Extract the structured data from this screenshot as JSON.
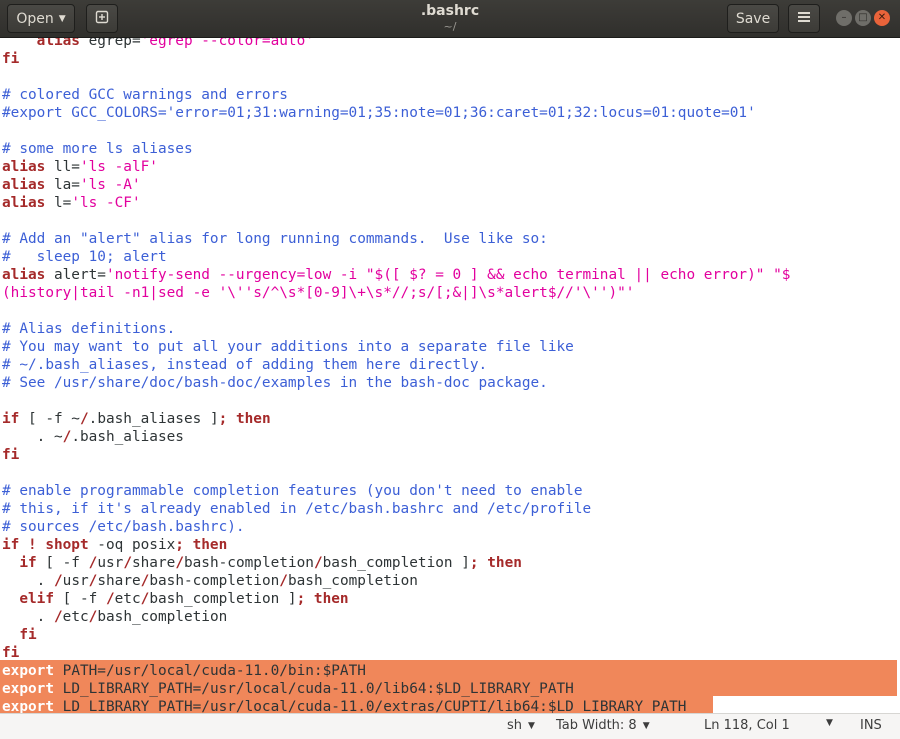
{
  "header": {
    "open_label": "Open",
    "title": ".bashrc",
    "subtitle": "~/",
    "save_label": "Save",
    "menu_icon": "hamburger-menu-icon",
    "new_doc_icon": "new-document-icon",
    "window_controls": {
      "minimize": "–",
      "maximize": "□",
      "close": "✕"
    }
  },
  "editor": {
    "lines": [
      [
        [
          "kw",
          "    alias "
        ],
        [
          "vr",
          "egrep="
        ],
        [
          "st",
          "'egrep --color=auto'"
        ]
      ],
      [
        [
          "kw",
          "fi"
        ]
      ],
      [],
      [
        [
          "cm",
          "# colored GCC warnings and errors"
        ]
      ],
      [
        [
          "cm",
          "#export GCC_COLORS='error=01;31:warning=01;35:note=01;36:caret=01;32:locus=01:quote=01'"
        ]
      ],
      [],
      [
        [
          "cm",
          "# some more ls aliases"
        ]
      ],
      [
        [
          "kw",
          "alias "
        ],
        [
          "vr",
          "ll="
        ],
        [
          "st",
          "'ls -alF'"
        ]
      ],
      [
        [
          "kw",
          "alias "
        ],
        [
          "vr",
          "la="
        ],
        [
          "st",
          "'ls -A'"
        ]
      ],
      [
        [
          "kw",
          "alias "
        ],
        [
          "vr",
          "l="
        ],
        [
          "st",
          "'ls -CF'"
        ]
      ],
      [],
      [
        [
          "cm",
          "# Add an \"alert\" alias for long running commands.  Use like so:"
        ]
      ],
      [
        [
          "cm",
          "#   sleep 10; alert"
        ]
      ],
      [
        [
          "kw",
          "alias "
        ],
        [
          "vr",
          "alert="
        ],
        [
          "st",
          "'notify-send --urgency=low -i \"$([ $? = 0 ] && echo terminal || echo error)\" \"$"
        ]
      ],
      [
        [
          "st",
          "(history|tail -n1|sed -e '\\''s/^\\s*[0-9]\\+\\s*//;s/[;&|]\\s*alert$//'\\'')\"'"
        ]
      ],
      [],
      [
        [
          "cm",
          "# Alias definitions."
        ]
      ],
      [
        [
          "cm",
          "# You may want to put all your additions into a separate file like"
        ]
      ],
      [
        [
          "cm",
          "# ~/.bash_aliases, instead of adding them here directly."
        ]
      ],
      [
        [
          "cm",
          "# See /usr/share/doc/bash-doc/examples in the bash-doc package."
        ]
      ],
      [],
      [
        [
          "kw",
          "if"
        ],
        [
          "vr",
          " [ -f ~"
        ],
        [
          "kw",
          "/"
        ],
        [
          "vr",
          ".bash_aliases ]"
        ],
        [
          "kw",
          "; then"
        ]
      ],
      [
        [
          "vr",
          "    . ~"
        ],
        [
          "kw",
          "/"
        ],
        [
          "vr",
          ".bash_aliases"
        ]
      ],
      [
        [
          "kw",
          "fi"
        ]
      ],
      [],
      [
        [
          "cm",
          "# enable programmable completion features (you don't need to enable"
        ]
      ],
      [
        [
          "cm",
          "# this, if it's already enabled in /etc/bash.bashrc and /etc/profile"
        ]
      ],
      [
        [
          "cm",
          "# sources /etc/bash.bashrc)."
        ]
      ],
      [
        [
          "kw",
          "if ! shopt"
        ],
        [
          "vr",
          " -oq posix"
        ],
        [
          "kw",
          "; then"
        ]
      ],
      [
        [
          "kw",
          "  if"
        ],
        [
          "vr",
          " [ -f "
        ],
        [
          "kw",
          "/"
        ],
        [
          "vr",
          "usr"
        ],
        [
          "kw",
          "/"
        ],
        [
          "vr",
          "share"
        ],
        [
          "kw",
          "/"
        ],
        [
          "vr",
          "bash-completion"
        ],
        [
          "kw",
          "/"
        ],
        [
          "vr",
          "bash_completion ]"
        ],
        [
          "kw",
          "; then"
        ]
      ],
      [
        [
          "vr",
          "    . "
        ],
        [
          "kw",
          "/"
        ],
        [
          "vr",
          "usr"
        ],
        [
          "kw",
          "/"
        ],
        [
          "vr",
          "share"
        ],
        [
          "kw",
          "/"
        ],
        [
          "vr",
          "bash-completion"
        ],
        [
          "kw",
          "/"
        ],
        [
          "vr",
          "bash_completion"
        ]
      ],
      [
        [
          "kw",
          "  elif"
        ],
        [
          "vr",
          " [ -f "
        ],
        [
          "kw",
          "/"
        ],
        [
          "vr",
          "etc"
        ],
        [
          "kw",
          "/"
        ],
        [
          "vr",
          "bash_completion ]"
        ],
        [
          "kw",
          "; then"
        ]
      ],
      [
        [
          "vr",
          "    . "
        ],
        [
          "kw",
          "/"
        ],
        [
          "vr",
          "etc"
        ],
        [
          "kw",
          "/"
        ],
        [
          "vr",
          "bash_completion"
        ]
      ],
      [
        [
          "kw",
          "  fi"
        ]
      ],
      [
        [
          "kw",
          "fi"
        ]
      ],
      [
        [
          "kw",
          "export "
        ],
        [
          "vr",
          "PATH=/usr/local/cuda-11.0/bin:$PATH"
        ]
      ],
      [
        [
          "kw",
          "export "
        ],
        [
          "vr",
          "LD_LIBRARY_PATH=/usr/local/cuda-11.0/lib64:$LD_LIBRARY_PATH"
        ]
      ],
      [
        [
          "kw",
          "export "
        ],
        [
          "vr",
          "LD_LIBRARY_PATH=/usr/local/cuda-11.0/extras/CUPTI/lib64:$LD_LIBRARY_PATH"
        ]
      ]
    ],
    "selected_from_line": 35,
    "colors": {
      "comment": "#3c5fd6",
      "keyword": "#a52a2a",
      "string": "#e2009e",
      "selection": "#f0875a"
    }
  },
  "statusbar": {
    "language": "sh",
    "tab_width": "Tab Width: 8",
    "position": "Ln 118, Col 1",
    "mode": "INS"
  }
}
